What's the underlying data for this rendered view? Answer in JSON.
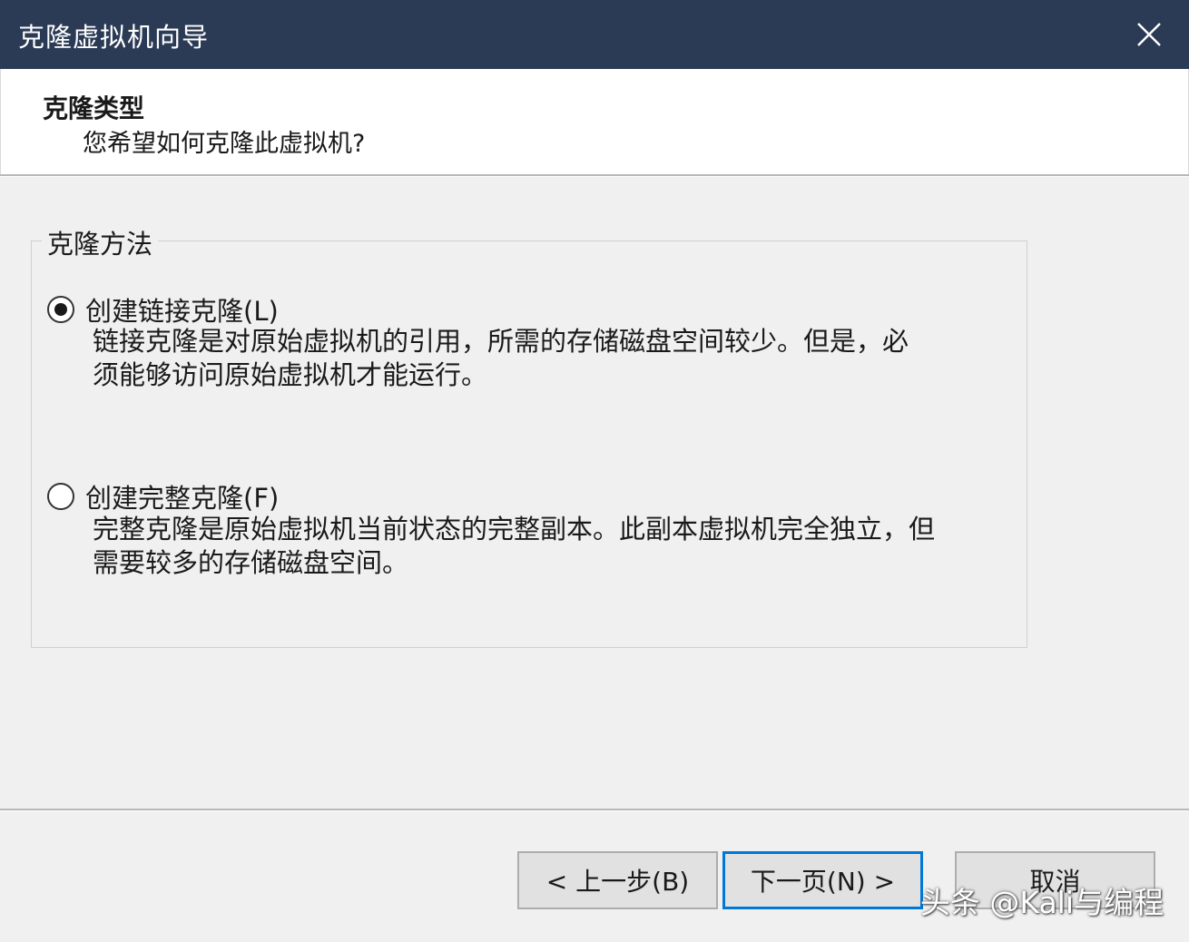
{
  "window": {
    "title": "克隆虚拟机向导",
    "close_icon": "close-icon"
  },
  "header": {
    "title": "克隆类型",
    "subtitle": "您希望如何克隆此虚拟机?"
  },
  "clone_method": {
    "legend": "克隆方法",
    "options": [
      {
        "label": "创建链接克隆(L)",
        "checked": true,
        "desc_line1": "链接克隆是对原始虚拟机的引用，所需的存储磁盘空间较少。但是，必",
        "desc_line2": "须能够访问原始虚拟机才能运行。"
      },
      {
        "label": "创建完整克隆(F)",
        "checked": false,
        "desc_line1": "完整克隆是原始虚拟机当前状态的完整副本。此副本虚拟机完全独立，但",
        "desc_line2": "需要较多的存储磁盘空间。"
      }
    ]
  },
  "buttons": {
    "back": "< 上一步(B)",
    "next": "下一页(N) >",
    "cancel": "取消"
  },
  "watermark": "头条 @Kali与编程",
  "colors": {
    "titlebar": "#2b3a55",
    "accent": "#0078d7",
    "background": "#f0f0f0"
  }
}
